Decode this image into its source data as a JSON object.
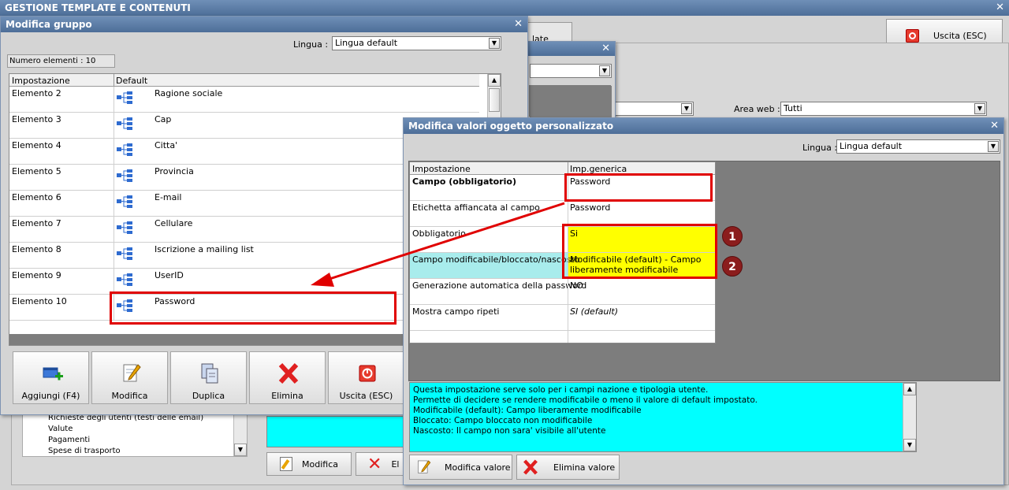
{
  "main_window": {
    "title": "GESTIONE TEMPLATE E CONTENUTI",
    "exit_label": "Uscita (ESC)"
  },
  "background": {
    "tab_fragment": "late",
    "area_web_label": "Area web :",
    "area_web_value": "Tutti",
    "tree_items": [
      "Richieste degli utenti (testi delle email)",
      "Valute",
      "Pagamenti",
      "Spese di trasporto"
    ],
    "modifica_label": "Modifica",
    "elimina_fragment": "El"
  },
  "gruppo_dialog": {
    "title": "Modifica gruppo",
    "lingua_label": "Lingua :",
    "lingua_value": "Lingua default",
    "count_label": "Numero elementi : 10",
    "columns": [
      "Impostazione",
      "Default"
    ],
    "rows": [
      {
        "name": "Elemento 2",
        "value": "Ragione sociale"
      },
      {
        "name": "Elemento 3",
        "value": "Cap"
      },
      {
        "name": "Elemento 4",
        "value": "Citta'"
      },
      {
        "name": "Elemento 5",
        "value": "Provincia"
      },
      {
        "name": "Elemento 6",
        "value": "E-mail"
      },
      {
        "name": "Elemento 7",
        "value": "Cellulare"
      },
      {
        "name": "Elemento 8",
        "value": "Iscrizione a mailing list"
      },
      {
        "name": "Elemento 9",
        "value": "UserID"
      },
      {
        "name": "Elemento 10",
        "value": "Password"
      }
    ],
    "buttons": {
      "add": "Aggiungi (F4)",
      "edit": "Modifica",
      "duplicate": "Duplica",
      "delete": "Elimina",
      "exit": "Uscita (ESC)"
    }
  },
  "custom_dialog": {
    "title": "Modifica valori oggetto personalizzato",
    "lingua_label": "Lingua :",
    "lingua_value": "Lingua default",
    "columns": [
      "Impostazione",
      "Imp.generica"
    ],
    "rows": [
      {
        "name": "Campo (obbligatorio)",
        "value": "Password"
      },
      {
        "name": "Etichetta affiancata al campo",
        "value": "Password"
      },
      {
        "name": "Obbligatorio",
        "value": "Si"
      },
      {
        "name": "Campo modificabile/bloccato/nascosto",
        "value": "Modificabile (default) - Campo liberamente modificabile"
      },
      {
        "name": "Generazione automatica della password",
        "value": "NO"
      },
      {
        "name": "Mostra campo ripeti",
        "value": "SI (default)"
      }
    ],
    "help_lines": [
      "Questa impostazione serve solo per i campi nazione e tipologia utente.",
      "Permette di decidere se rendere modificabile o meno il valore di default impostato.",
      "Modificabile (default): Campo liberamente modificabile",
      "Bloccato: Campo bloccato non modificabile",
      "Nascosto: Il campo non sara' visibile all'utente"
    ],
    "buttons": {
      "edit_value": "Modifica valore",
      "delete_value": "Elimina valore"
    }
  },
  "annotations": {
    "badge1": "1",
    "badge2": "2"
  },
  "colors": {
    "highlight_yellow": "#ffff00",
    "highlight_cyan": "#a8ecec",
    "help_cyan": "#00ffff",
    "annotation_red": "#e00000"
  }
}
